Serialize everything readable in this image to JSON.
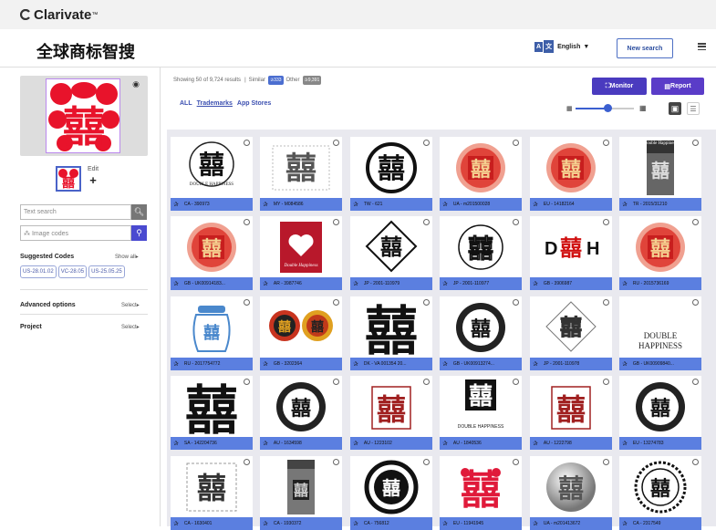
{
  "brand": {
    "name": "Clarivate",
    "mark": "™"
  },
  "header": {
    "app_title": "全球商标智搜",
    "language": "English",
    "new_search": "New search"
  },
  "sidebar": {
    "edit_label": "Edit",
    "add_label": "+",
    "text_search_placeholder": "Text search",
    "image_codes_placeholder": "Image codes",
    "suggested_codes_title": "Suggested Codes",
    "show_all": "Show all",
    "codes": [
      "US-28.01.02",
      "VC-28.05",
      "US-25.05.25"
    ],
    "advanced_options": "Advanced options",
    "advanced_select": "Select",
    "project": "Project",
    "project_select": "Select"
  },
  "results_header": {
    "showing": "Showing 50 of 9,724 results",
    "similar_label": "Similar",
    "similar_count": "333",
    "other_label": "Other",
    "other_count": "9,391",
    "tabs": [
      "ALL",
      "Trademarks",
      "App Stores"
    ],
    "monitor": "Monitor",
    "report": "Report",
    "thumb_size_fraction": 0.55
  },
  "cards": [
    {
      "id": "CA - 390973",
      "glyph": "囍",
      "style": "circle-black",
      "caption": "DOUBLE HAPPINESS"
    },
    {
      "id": "MY - M084586",
      "glyph": "囍",
      "style": "ornate",
      "caption": ""
    },
    {
      "id": "TW - 621",
      "glyph": "囍",
      "style": "ring-black",
      "caption": ""
    },
    {
      "id": "UA - m201500028",
      "glyph": "囍",
      "style": "red-seal",
      "caption": ""
    },
    {
      "id": "EU - 14182164",
      "glyph": "囍",
      "style": "red-seal",
      "caption": ""
    },
    {
      "id": "TR - 2015/31210",
      "glyph": "囍",
      "style": "pack-gray",
      "caption": "Double Happiness"
    },
    {
      "id": "GB - UK00914183...",
      "glyph": "囍",
      "style": "red-seal",
      "caption": ""
    },
    {
      "id": "AR - 3987746",
      "glyph": "♥",
      "style": "red-square",
      "caption": "Double Happiness"
    },
    {
      "id": "JP - 2001-110979",
      "glyph": "囍",
      "style": "diamond",
      "caption": ""
    },
    {
      "id": "JP - 2001-110977",
      "glyph": "囍",
      "style": "circle-outline",
      "caption": ""
    },
    {
      "id": "GB - 3906987",
      "glyph": "囍",
      "style": "dh-text",
      "caption": ""
    },
    {
      "id": "RU - 2015736169",
      "glyph": "囍",
      "style": "red-seal",
      "caption": ""
    },
    {
      "id": "RU - 2017754772",
      "glyph": "囍",
      "style": "jar",
      "caption": ""
    },
    {
      "id": "GB - 3202364",
      "glyph": "囍",
      "style": "two-seals",
      "caption": ""
    },
    {
      "id": "DK - VA 001354 20...",
      "glyph": "囍",
      "style": "big-black",
      "caption": ""
    },
    {
      "id": "GB - UK00913274...",
      "glyph": "囍",
      "style": "circle-dark",
      "caption": ""
    },
    {
      "id": "JP - 2001-110978",
      "glyph": "囍",
      "style": "diamond-thin",
      "caption": ""
    },
    {
      "id": "GB - UK00909840...",
      "glyph": "囍",
      "style": "dh-words",
      "caption": "DOUBLE HAPPINESS"
    },
    {
      "id": "SA - 142204736",
      "glyph": "囍",
      "style": "big-black",
      "caption": ""
    },
    {
      "id": "AU - 1634598",
      "glyph": "囍",
      "style": "circle-dark",
      "caption": ""
    },
    {
      "id": "AU - 1223102",
      "glyph": "囍",
      "style": "framed-red",
      "caption": ""
    },
    {
      "id": "AU - 1840536",
      "glyph": "囍",
      "style": "square-black",
      "caption": "DOUBLE HAPPINESS"
    },
    {
      "id": "AU - 1222798",
      "glyph": "囍",
      "style": "framed-red",
      "caption": ""
    },
    {
      "id": "EU - 13274783",
      "glyph": "囍",
      "style": "circle-dark",
      "caption": ""
    },
    {
      "id": "CA - 1630401",
      "glyph": "囍",
      "style": "ornate-dark",
      "caption": ""
    },
    {
      "id": "CA - 1930372",
      "glyph": "囍",
      "style": "pack-dark",
      "caption": ""
    },
    {
      "id": "CA - 756812",
      "glyph": "囍",
      "style": "ring-text",
      "caption": ""
    },
    {
      "id": "EU - 11941945",
      "glyph": "囍",
      "style": "red-cut",
      "caption": ""
    },
    {
      "id": "UA - m201413672",
      "glyph": "囍",
      "style": "silver-ball",
      "caption": ""
    },
    {
      "id": "CA - 2317549",
      "glyph": "囍",
      "style": "ring-dots",
      "caption": ""
    }
  ]
}
